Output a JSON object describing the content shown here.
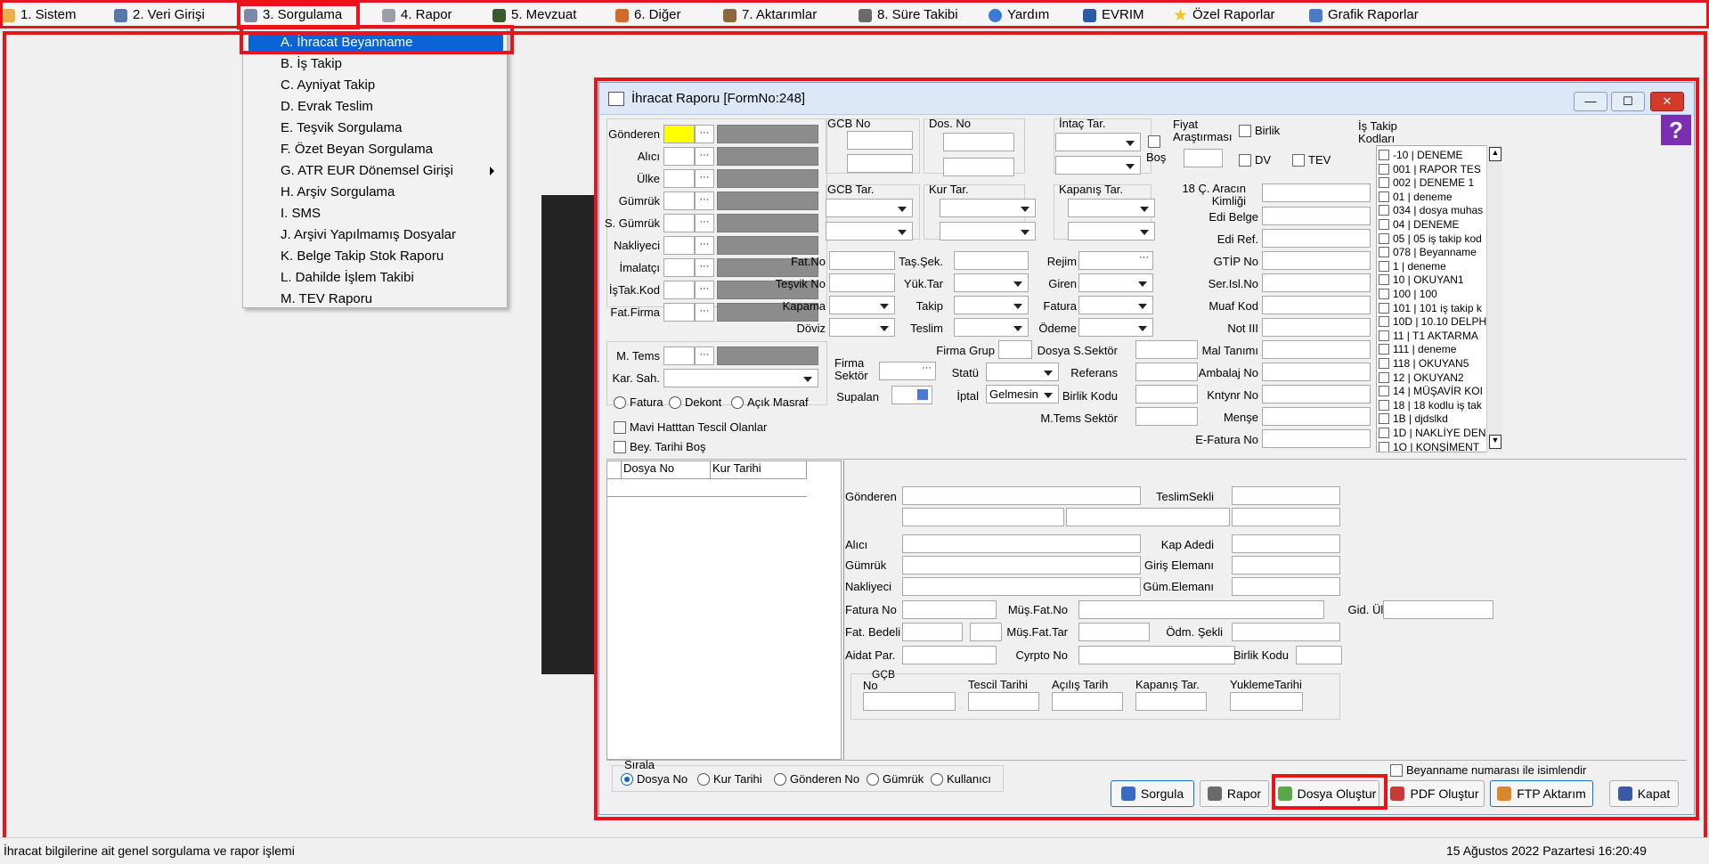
{
  "menubar": {
    "items": [
      {
        "label": "1.  Sistem",
        "icon": "system-icon"
      },
      {
        "label": "2.  Veri Girişi",
        "icon": "data-entry-icon"
      },
      {
        "label": "3.  Sorgulama",
        "icon": "query-icon"
      },
      {
        "label": "4.  Rapor",
        "icon": "printer-icon"
      },
      {
        "label": "5.  Mevzuat",
        "icon": "books-icon"
      },
      {
        "label": "6.  Diğer",
        "icon": "other-icon"
      },
      {
        "label": "7.  Aktarımlar",
        "icon": "transfer-icon"
      },
      {
        "label": "8. Süre Takibi",
        "icon": "timer-icon"
      },
      {
        "label": "Yardım",
        "icon": "help-icon"
      },
      {
        "label": "EVRIM",
        "icon": "evrim-icon"
      },
      {
        "label": "Özel Raporlar",
        "icon": "star-icon"
      },
      {
        "label": "Grafik Raporlar",
        "icon": "chart-icon"
      }
    ]
  },
  "dropdown": {
    "items": [
      "A.  İhracat Beyanname",
      "B.  İş Takip",
      "C.  Ayniyat Takip",
      "D.  Evrak Teslim",
      "E.  Teşvik Sorgulama",
      "F.  Özet Beyan Sorgulama",
      "G.  ATR EUR Dönemsel Girişi",
      "H.  Arşiv Sorgulama",
      "I.  SMS",
      "J.  Arşivi Yapılmamış Dosyalar",
      "K.  Belge Takip Stok Raporu",
      "L. Dahilde İşlem Takibi",
      "M. TEV Raporu"
    ]
  },
  "window": {
    "title": "İhracat Raporu [FormNo:248]",
    "left_labels": [
      "Gönderen",
      "Alıcı",
      "Ülke",
      "Gümrük",
      "S. Gümrük",
      "Nakliyeci",
      "İmalatçı",
      "İşTak.Kod",
      "Fat.Firma"
    ],
    "m_tems": "M. Tems",
    "kar_sah": "Kar. Sah.",
    "radio_fatura": "Fatura",
    "radio_dekont": "Dekont",
    "radio_acik": "Açık Masraf",
    "chk_mavi": "Mavi Hatttan Tescil Olanlar",
    "chk_bey": "Bey. Tarihi Boş",
    "gcb_no": "GCB No",
    "dos_no": "Dos. No",
    "intac_tar": "İntaç Tar.",
    "bos": "Boş",
    "fiyat_arastirmasi": "Fiyat Araştırması",
    "birlik": "Birlik",
    "dv": "DV",
    "tev": "TEV",
    "is_takip_kodlari": "İş Takip Kodları",
    "gcb_tar": "GCB Tar.",
    "kur_tar": "Kur Tar.",
    "kapanis_tar": "Kapanış Tar.",
    "arac_kimligi": "18 Ç. Aracın Kimliği",
    "edi_belge": "Edi Belge",
    "edi_ref": "Edi Ref.",
    "gtip_no": "GTİP No",
    "ser_isl_no": "Ser.Isl.No",
    "muaf_kod": "Muaf Kod",
    "not_iii": "Not III",
    "mal_tanimi": "Mal Tanımı",
    "ambalaj_no": "Ambalaj No",
    "kntynr_no": "Kntynr No",
    "mense": "Menşe",
    "e_fatura_no": "E-Fatura No",
    "fat_no": "Fat.No",
    "tesvik_no": "Teşvik No",
    "kapama": "Kapama",
    "doviz": "Döviz",
    "tas_sek": "Taş.Şek.",
    "yuk_tar": "Yük.Tar",
    "takip": "Takip",
    "teslim": "Teslim",
    "rejim": "Rejim",
    "giren": "Giren",
    "fatura": "Fatura",
    "odeme": "Ödeme",
    "firma_grup": "Firma Grup",
    "dosya_s_sektor": "Dosya S.Sektör",
    "firma_sektor": "Firma Sektör",
    "statu": "Statü",
    "referans": "Referans",
    "supalan": "Supalan",
    "iptal": "İptal",
    "iptal_value": "Gelmesin",
    "birlik_kodu": "Birlik Kodu",
    "m_tems_sektor": "M.Tems Sektör",
    "is_takip_kodlari_list": [
      "-10 | DENEME",
      "001 | RAPOR TES",
      "002 | DENEME 1",
      "01 | deneme",
      "034 | dosya muhas",
      "04 | DENEME",
      "05 | 05 iş takip kod",
      "078 | Beyanname",
      "1 | deneme",
      "10 | OKUYAN1",
      "100 | 100",
      "101 | 101 iş takip k",
      "10D | 10.10 DELPH",
      "11 | T1 AKTARMA",
      "111 | deneme",
      "118 | OKUYAN5",
      "12 | OKUYAN2",
      "14 | MÜŞAVİR KOI",
      "18 | 18 kodlu iş tak",
      "1B | djdslkd",
      "1D | NAKLİYE DEN",
      "1O | KONŞİMENT"
    ],
    "grid_cols": [
      "Dosya No",
      "Kur Tarihi"
    ],
    "detail": {
      "gonderen": "Gönderen",
      "teslim_sekli": "TeslimSekli",
      "alici": "Alıcı",
      "kap_adedi": "Kap Adedi",
      "gumruk": "Gümrük",
      "giris_elemani": "Giriş Elemanı",
      "nakliyeci": "Nakliyeci",
      "gum_elemani": "Güm.Elemanı",
      "fatura_no": "Fatura No",
      "mus_fat_no": "Müş.Fat.No",
      "gid_ulke": "Gid. Ülke",
      "fat_bedeli": "Fat. Bedeli",
      "mus_fat_tar": "Müş.Fat.Tar",
      "odm_sekli": "Ödm. Şekli",
      "aidat_par": "Aidat Par.",
      "cyrpto_no": "Cyrpto No",
      "birlik_kodu": "Birlik Kodu",
      "gcb": "GÇB",
      "no": "No",
      "tescil_tarihi": "Tescil Tarihi",
      "acilis_tarih": "Açılış Tarih",
      "kapanis_tar": "Kapanış Tar.",
      "yukleme_tarihi": "YuklemeTarihi"
    },
    "sirala": {
      "title": "Sırala",
      "options": [
        "Dosya No",
        "Kur Tarihi",
        "Gönderen No",
        "Gümrük",
        "Kullanıcı"
      ],
      "selected": "Dosya No"
    },
    "beyanname_chk": "Beyanname numarası ile isimlendir",
    "buttons": [
      "Sorgula",
      "Rapor",
      "Dosya Oluştur",
      "PDF Oluştur",
      "FTP Aktarım",
      "Kapat"
    ]
  },
  "statusbar": {
    "left": "İhracat bilgilerine ait genel sorgulama ve rapor işlemi",
    "right": "15 Ağustos 2022 Pazartesi 16:20:49"
  },
  "colors": {
    "highlight_red": "#e8141c",
    "selection_blue": "#0a64d6",
    "gonderen_yellow": "#ffff00"
  }
}
